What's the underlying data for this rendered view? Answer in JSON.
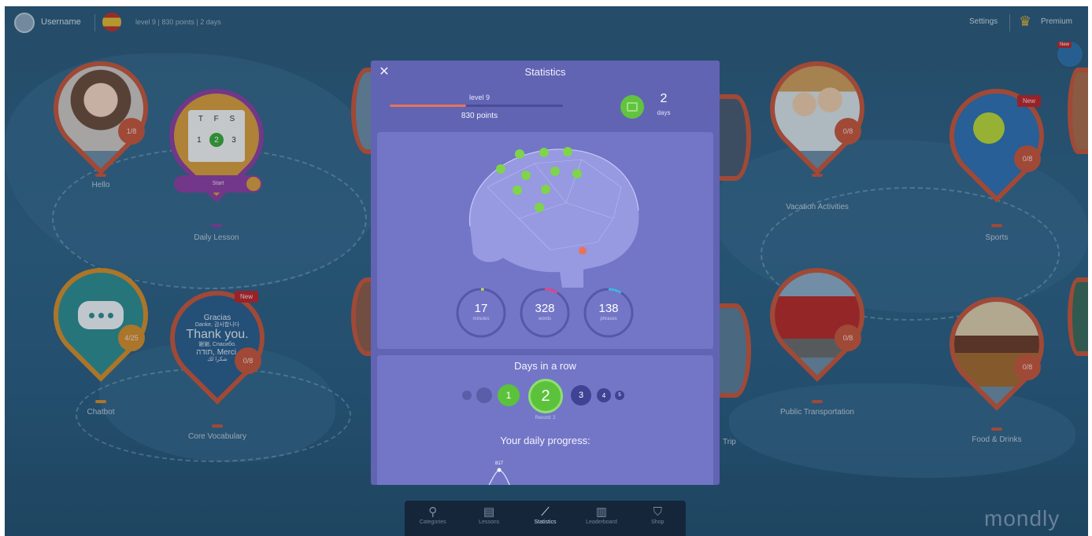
{
  "topbar": {
    "username": "Username",
    "stats": "level 9  |  830 points  |  2 days",
    "settings": "Settings",
    "premium": "Premium"
  },
  "badges": {
    "new": "New"
  },
  "lessons": [
    {
      "label": "Hello",
      "progress": "1/8"
    },
    {
      "label": "Daily Lesson",
      "cal_days": [
        "T",
        "F",
        "S"
      ],
      "cal_nums": [
        "1",
        "2",
        "3"
      ],
      "start": "Start"
    },
    {
      "label": "Chatbot",
      "progress": "4/25"
    },
    {
      "label": "Core Vocabulary",
      "progress": "0/8",
      "card_text": [
        "Gracias",
        "Danke, 감사합니다",
        "Thank you.",
        "谢谢, Спасибо.",
        "תודה, Merci,",
        "شكرا لك"
      ]
    },
    {
      "label": "Vacation Activities",
      "progress": "0/8"
    },
    {
      "label": "Sports",
      "progress": "0/8"
    },
    {
      "label": "Public Transportation",
      "progress": "0/8"
    },
    {
      "label": "Food & Drinks",
      "progress": "0/8"
    },
    {
      "label": "Trip"
    }
  ],
  "modal": {
    "close": "✕",
    "title": "Statistics",
    "level": "level 9",
    "level_progress": 0.44,
    "points": "830 points",
    "days_count": "2",
    "days_label": "days",
    "rings": [
      {
        "value": "17",
        "label": "minutes",
        "color": "#c8e04a"
      },
      {
        "value": "328",
        "label": "words",
        "color": "#e0458a"
      },
      {
        "value": "138",
        "label": "phrases",
        "color": "#3fb6e0"
      }
    ],
    "days_in_row_title": "Days in a row",
    "day_numbers": [
      "1",
      "2",
      "3",
      "4",
      "5"
    ],
    "best": "Record: 2",
    "daily_progress_title": "Your daily progress:",
    "chart_peak": "817"
  },
  "bottomnav": [
    {
      "label": "Categories",
      "icon": "categories-icon"
    },
    {
      "label": "Lessons",
      "icon": "lessons-icon"
    },
    {
      "label": "Statistics",
      "icon": "statistics-icon"
    },
    {
      "label": "Leaderboard",
      "icon": "leaderboard-icon"
    },
    {
      "label": "Shop",
      "icon": "shop-icon"
    }
  ],
  "brand": "mondly",
  "colors": {
    "accent_green": "#62c340",
    "pin_orange": "#c2553c",
    "modal_bg": "#6164b2",
    "new_red": "#b8262b"
  }
}
